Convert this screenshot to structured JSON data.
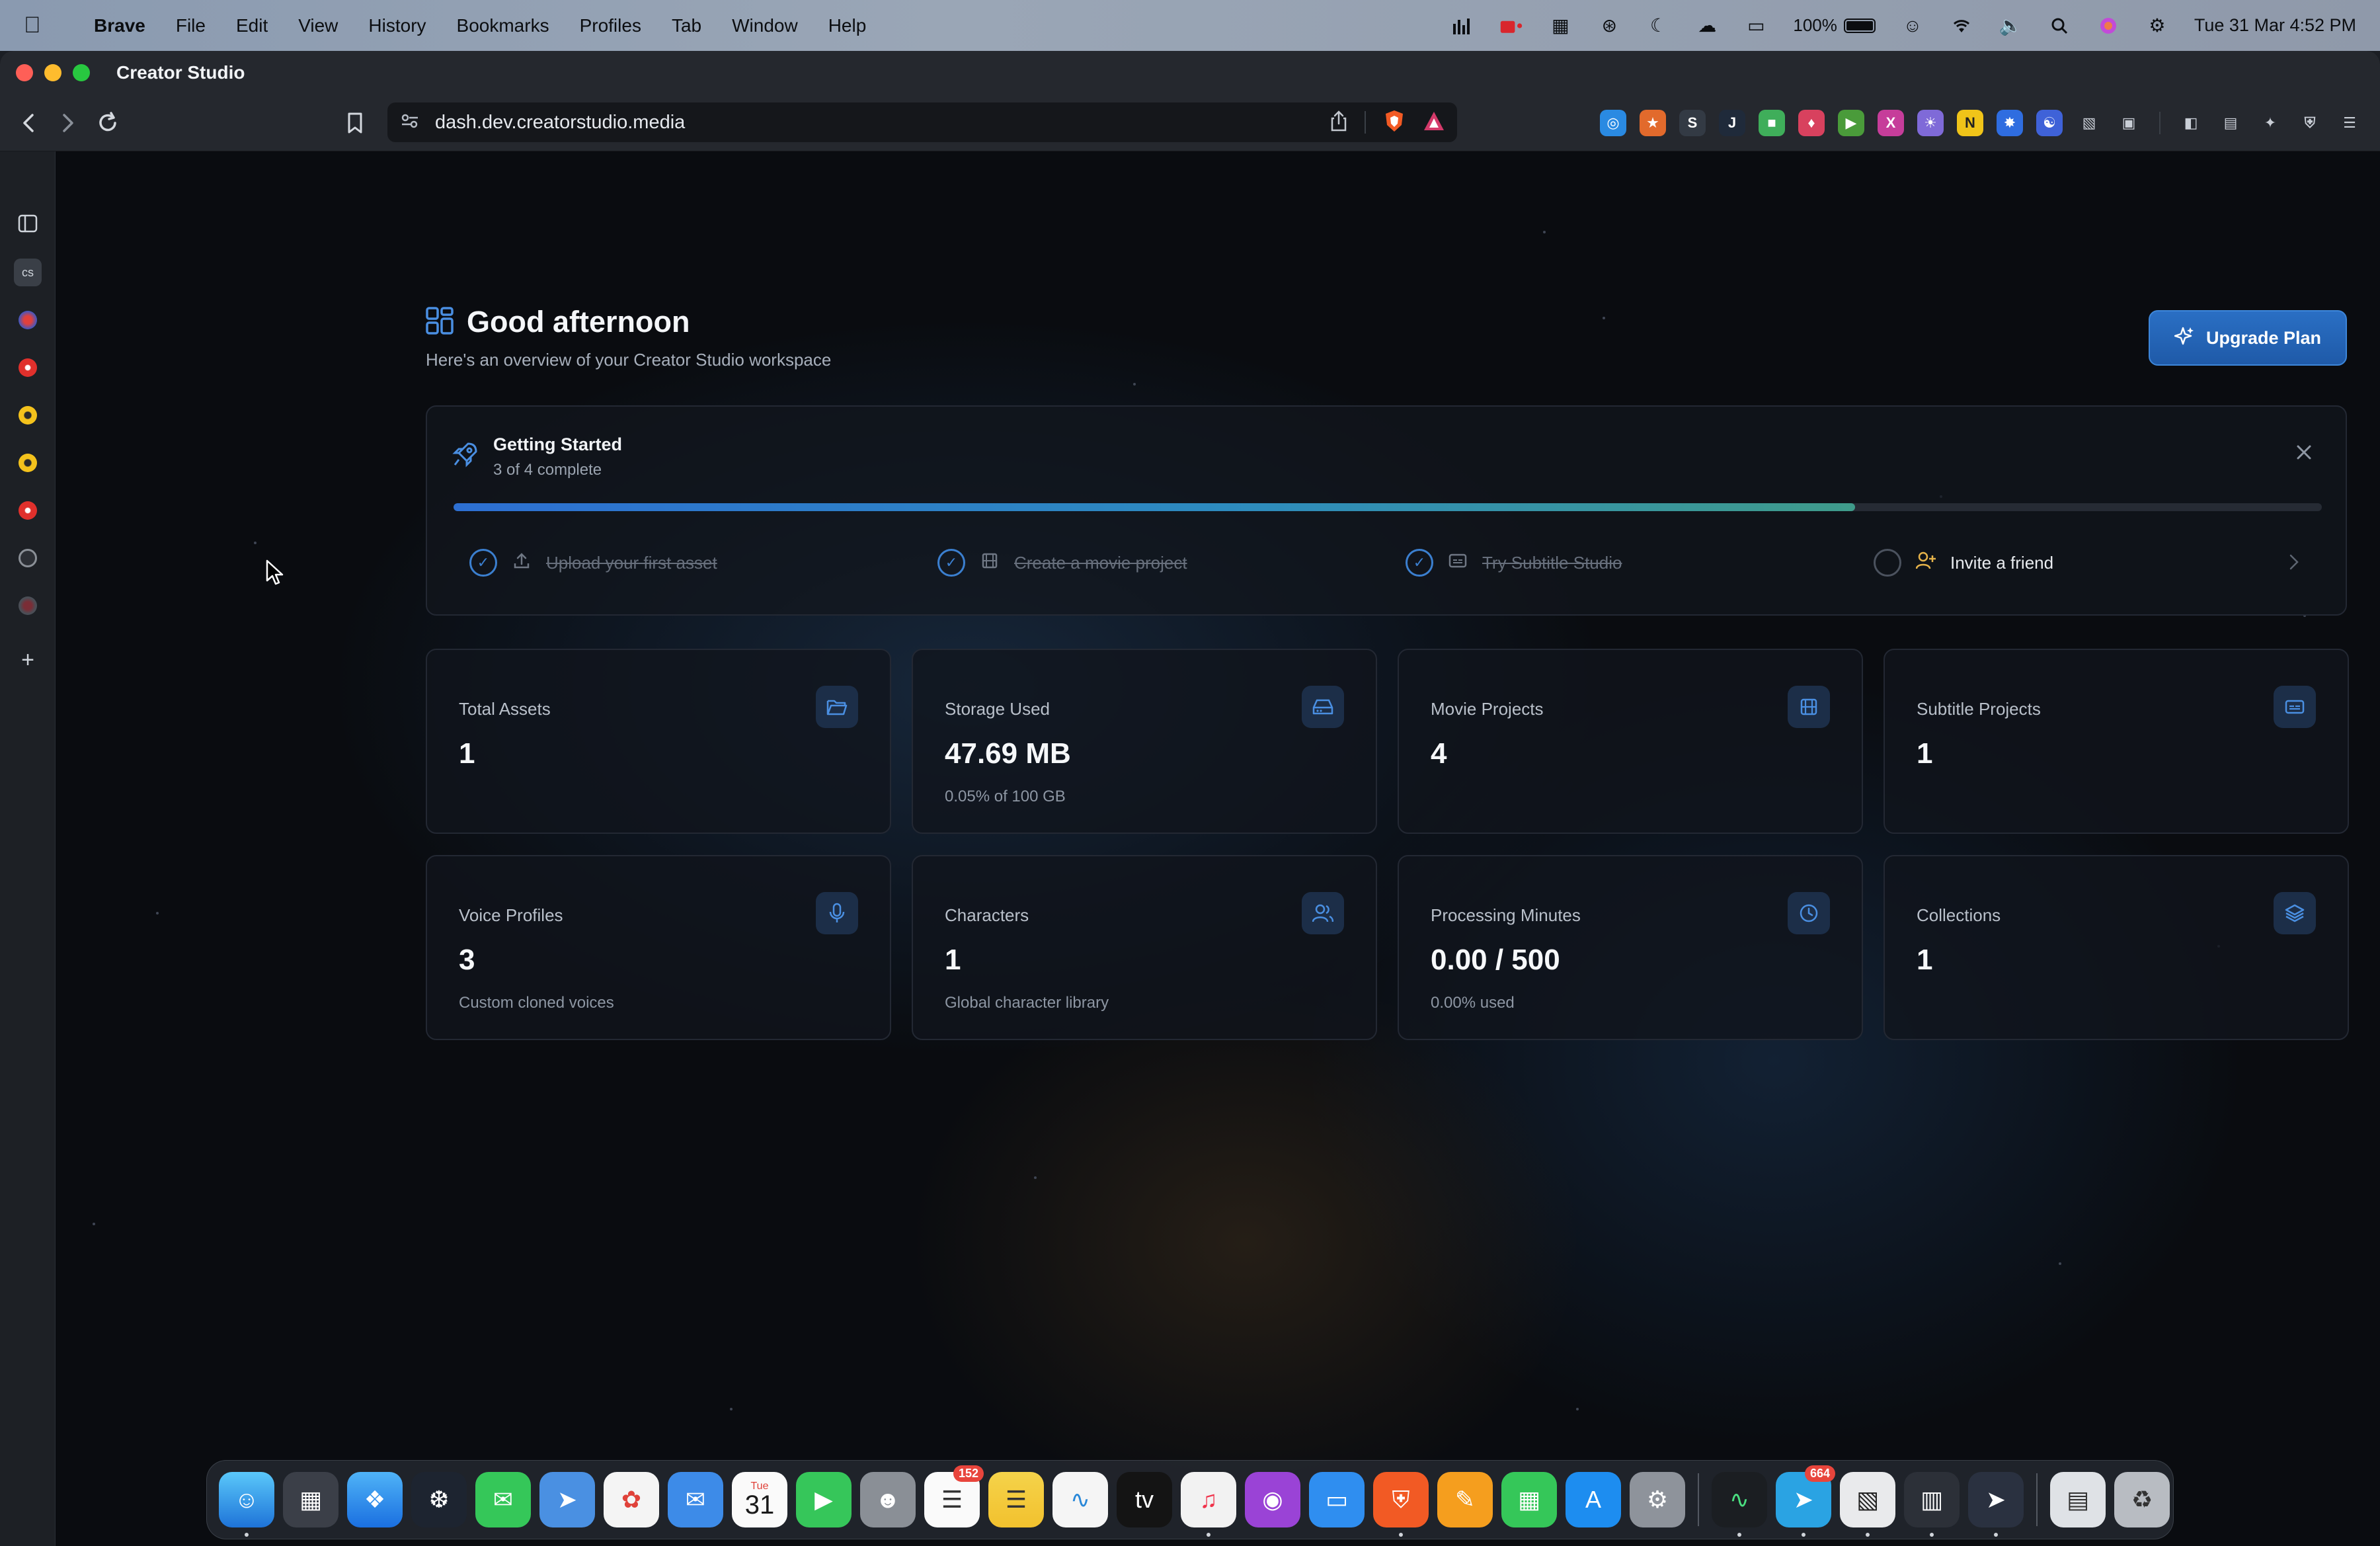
{
  "menubar": {
    "app_name": "Brave",
    "menus": [
      "File",
      "Edit",
      "View",
      "History",
      "Bookmarks",
      "Profiles",
      "Tab",
      "Window",
      "Help"
    ],
    "battery_percent": "100%",
    "clock": "Tue 31 Mar  4:52 PM"
  },
  "browser": {
    "window_title": "Creator Studio",
    "url": "dash.dev.creatorstudio.media",
    "extension_colors": [
      "#2a8ae2",
      "#e26a2c",
      "#333a44",
      "#1f2a3a",
      "#3fae5a",
      "#d8415e",
      "#4a9b3a",
      "#c63d9a",
      "#7f6ad8",
      "#f0c419",
      "#2f6de0",
      "#3f62d8"
    ]
  },
  "sidebar_rail": {
    "active_tab": "cs"
  },
  "dashboard": {
    "greeting": "Good afternoon",
    "subtitle": "Here's an overview of your Creator Studio workspace",
    "upgrade_label": "Upgrade Plan",
    "getting_started": {
      "title": "Getting Started",
      "progress_text": "3 of 4 complete",
      "progress_fraction": 0.75,
      "steps": [
        {
          "label": "Upload your first asset",
          "done": true
        },
        {
          "label": "Create a movie project",
          "done": true
        },
        {
          "label": "Try Subtitle Studio",
          "done": true
        },
        {
          "label": "Invite a friend",
          "done": false
        }
      ]
    },
    "stats": [
      {
        "label": "Total Assets",
        "value": "1",
        "sub": "",
        "icon": "folder-icon"
      },
      {
        "label": "Storage Used",
        "value": "47.69 MB",
        "sub": "0.05% of 100 GB",
        "icon": "drive-icon"
      },
      {
        "label": "Movie Projects",
        "value": "4",
        "sub": "",
        "icon": "film-icon"
      },
      {
        "label": "Subtitle Projects",
        "value": "1",
        "sub": "",
        "icon": "captions-icon"
      },
      {
        "label": "Voice Profiles",
        "value": "3",
        "sub": "Custom cloned voices",
        "icon": "microphone-icon"
      },
      {
        "label": "Characters",
        "value": "1",
        "sub": "Global character library",
        "icon": "users-icon"
      },
      {
        "label": "Processing Minutes",
        "value": "0.00 / 500",
        "sub": "0.00% used",
        "icon": "clock-icon"
      },
      {
        "label": "Collections",
        "value": "1",
        "sub": "",
        "icon": "layers-icon"
      }
    ]
  },
  "dock": {
    "calendar_month": "Tue",
    "calendar_day": "31",
    "reminders_badge": "152",
    "telegram_badge": "664"
  }
}
